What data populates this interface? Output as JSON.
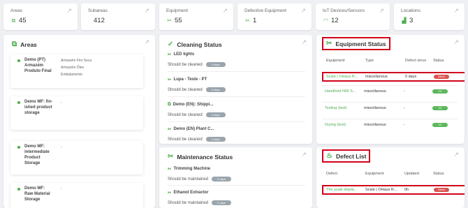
{
  "stats": [
    {
      "label": "Areas",
      "value": "45",
      "icon": "areas-icon"
    },
    {
      "label": "Subareas",
      "value": "412",
      "icon": ""
    },
    {
      "label": "Equipment",
      "value": "55",
      "icon": "equipment-icon"
    },
    {
      "label": "Defective Equipment",
      "value": "1",
      "icon": "defective-equipment-icon"
    },
    {
      "label": "IoT Devices/Sensors",
      "value": "12",
      "icon": "wifi-icon"
    },
    {
      "label": "Locations",
      "value": "3",
      "icon": "factory-icon"
    }
  ],
  "areas": {
    "title": "Areas",
    "items": [
      {
        "name": "Demo (PT) Armazém Produto Final",
        "subareas": [
          "Armazém Flor Seca",
          "Armazém Óleo",
          "Embalamento"
        ]
      },
      {
        "name": "Demo MF: fin-ished product storage",
        "subareas": [
          "-"
        ]
      },
      {
        "name": "Demo MF: intermediate Product Storage",
        "subareas": [
          "-"
        ]
      },
      {
        "name": "Demo MF: Raw Material Storage",
        "subareas": [
          "-"
        ]
      }
    ]
  },
  "cleaning": {
    "title": "Cleaning Status",
    "items": [
      {
        "name": "LED lights",
        "status": "Should be cleaned",
        "pill": "2 days"
      },
      {
        "name": "Lupa - Teste - PT",
        "status": "Should be cleaned",
        "pill": "2 days"
      },
      {
        "name": "Demo (EN): Shippi...",
        "status": "Should be cleaned",
        "pill": "2 days"
      },
      {
        "name": "Demo (EN) Plant C...",
        "status": "Should be cleaned",
        "pill": "2 days"
      }
    ]
  },
  "maintenance": {
    "title": "Maintenance Status",
    "items": [
      {
        "name": "Trimming Machine",
        "status": "Should be maintained",
        "pill": "9 days"
      },
      {
        "name": "Ethanol Extractor",
        "status": "Should be maintained",
        "pill": "9 days"
      }
    ]
  },
  "equipment_status": {
    "title": "Equipment Status",
    "headers": [
      "Equipment",
      "Type",
      "Defect since",
      "Status"
    ],
    "rows": [
      {
        "equipment": "Scale | OHaus R...",
        "type": "miscellanous",
        "since": "0 days",
        "status": "Defect",
        "color": "#d9534f"
      },
      {
        "equipment": "Handheld NIR S...",
        "type": "miscellanous",
        "since": "-",
        "status": "OK",
        "color": "#5cb85c"
      },
      {
        "equipment": "Testing (test)",
        "type": "miscellanous",
        "since": "-",
        "status": "OK",
        "color": "#5cb85c"
      },
      {
        "equipment": "Drying (test)",
        "type": "miscellanous",
        "since": "-",
        "status": "OK",
        "color": "#5cb85c"
      }
    ]
  },
  "defect_list": {
    "title": "Defect List",
    "headers": [
      "Defect",
      "Equipment",
      "Updated",
      "Status"
    ],
    "rows": [
      {
        "defect": "The scale displa...",
        "equipment": "Scale | OHaus R...",
        "updated": "0h",
        "status": "Defect"
      }
    ]
  }
}
